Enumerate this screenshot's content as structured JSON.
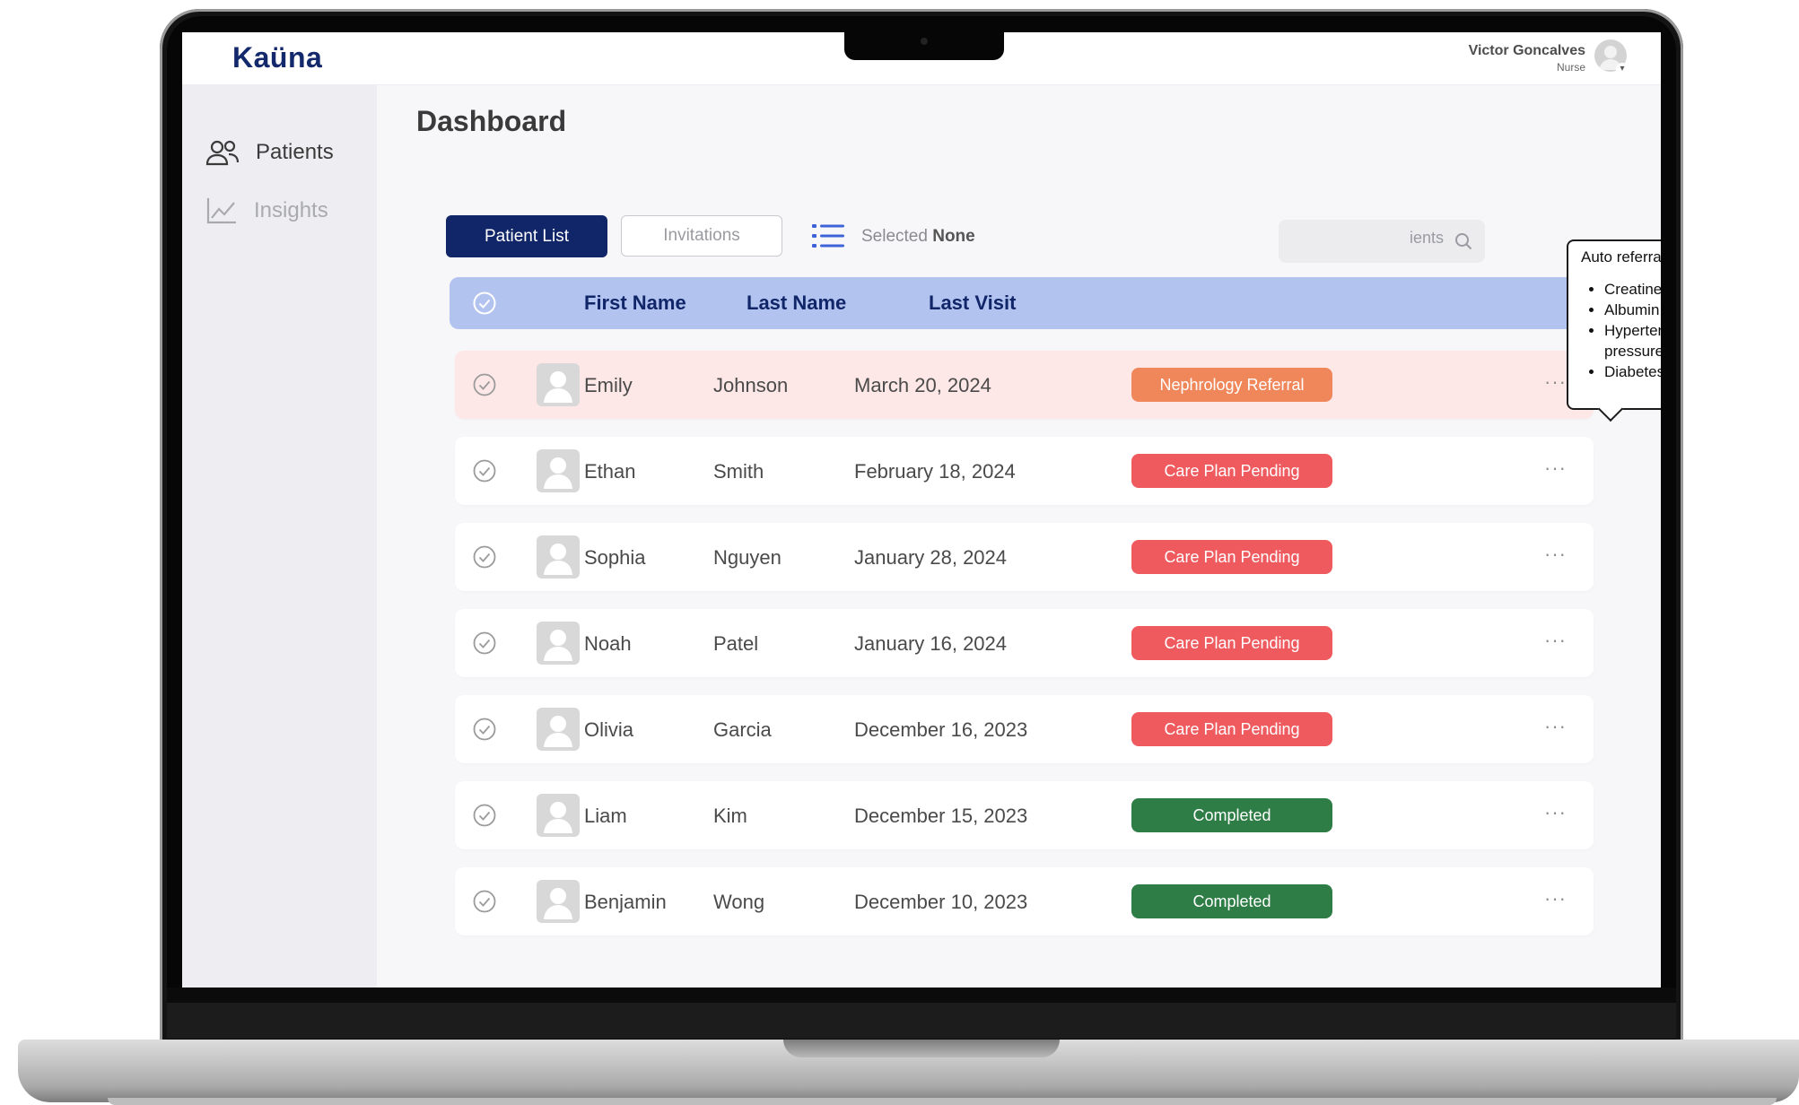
{
  "app": {
    "logo": "Kaüna"
  },
  "user": {
    "name": "Victor Goncalves",
    "role": "Nurse"
  },
  "sidebar": {
    "items": [
      {
        "label": "Patients",
        "active": true
      },
      {
        "label": "Insights",
        "active": false
      }
    ]
  },
  "page": {
    "title": "Dashboard"
  },
  "toolbar": {
    "tab_patient_list": "Patient List",
    "tab_invitations": "Invitations",
    "selected_label": "Selected",
    "selected_value": "None",
    "search_visible_text": "ients"
  },
  "table": {
    "headers": {
      "first_name": "First Name",
      "last_name": "Last Name",
      "last_visit": "Last Visit"
    },
    "rows": [
      {
        "first": "Emily",
        "last": "Johnson",
        "visit": "March 20, 2024",
        "status": "Nephrology Referral",
        "status_color": "#f0875a",
        "warning": true
      },
      {
        "first": "Ethan",
        "last": "Smith",
        "visit": "February 18, 2024",
        "status": "Care Plan Pending",
        "status_color": "#ef5a5f",
        "warning": false
      },
      {
        "first": "Sophia",
        "last": "Nguyen",
        "visit": "January 28, 2024",
        "status": "Care Plan Pending",
        "status_color": "#ef5a5f",
        "warning": false
      },
      {
        "first": "Noah",
        "last": "Patel",
        "visit": "January 16, 2024",
        "status": "Care Plan Pending",
        "status_color": "#ef5a5f",
        "warning": false
      },
      {
        "first": "Olivia",
        "last": "Garcia",
        "visit": "December 16, 2023",
        "status": "Care Plan Pending",
        "status_color": "#ef5a5f",
        "warning": false
      },
      {
        "first": "Liam",
        "last": "Kim",
        "visit": "December 15, 2023",
        "status": "Completed",
        "status_color": "#2e7d46",
        "warning": false
      },
      {
        "first": "Benjamin",
        "last": "Wong",
        "visit": "December 10, 2023",
        "status": "Completed",
        "status_color": "#2e7d46",
        "warning": false
      }
    ],
    "more_label": "···"
  },
  "tooltip": {
    "title": "Auto referral detection using:",
    "items": [
      "Creatine",
      "Albumin in the urine (URIA)",
      "Hypertension status (blood pressure)",
      "Diabetes status"
    ]
  },
  "colors": {
    "brand": "#102668",
    "header_bg": "#b3c3f0",
    "highlight_row": "#fde7e7"
  },
  "icons": {
    "patients": "users-icon",
    "insights": "chart-line-icon",
    "list": "list-icon",
    "search": "search-icon",
    "warning": "warning-triangle-icon",
    "check": "check-circle-icon"
  }
}
